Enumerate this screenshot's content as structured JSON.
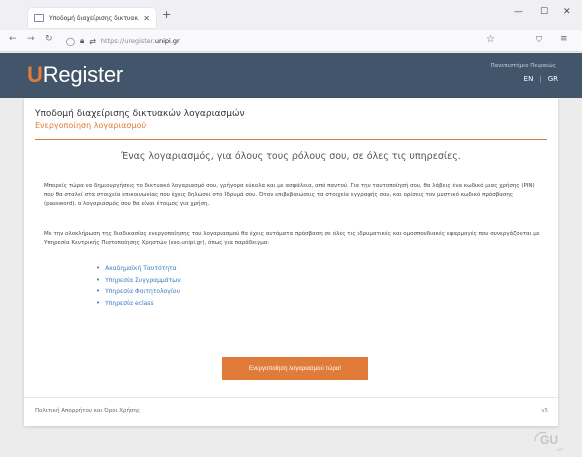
{
  "browser": {
    "tab_title": "Υποδομή διαχείρισης δικτυακ…",
    "url_prefix": "https://uregister.",
    "url_domain": "unipi.gr"
  },
  "header": {
    "logo_u": "U",
    "logo_rest": "Register",
    "university": "Πανεπιστήμιο Πειραιώς",
    "lang_en": "EN",
    "lang_gr": "GR"
  },
  "card": {
    "title": "Υποδομή διαχείρισης δικτυακών λογαριασμών",
    "subtitle": "Ενεργοποίηση λογαριασμού",
    "tagline": "Ένας λογαριασμός, για όλους τους ρόλους σου, σε όλες τις υπηρεσίες.",
    "para1": "Μπορείς τώρα να δημιουργήσεις το δικτυακό λογαριασμό σου, γρήγορα εύκολα και με ασφάλεια, από παντού. Για την ταυτοποίησή σου, θα λάβεις ένα κωδικό μιας χρήσης (PIN) που θα σταλεί στα στοιχεία επικοινωνίας που έχεις δηλώσει στο Ίδρυμά σου. Όταν επιβεβαιώσεις τα στοιχεία εγγραφής σου, και ορίσεις τον μυστικό κωδικό πρόσβασης (password), ο λογαριασμός σου θα είναι έτοιμος για χρήση.",
    "para2": "Με την ολοκλήρωση της διαδικασίας ενεργοποίησης του λογαριασμού θα έχεις αυτόματα πρόσβαση σε όλες τις ιδρυματικές και ομοσπονδιακές εφαρμογές που συνεργάζονται με Υπηρεσία Κεντρικής Πιστοποίησης Χρηστών (sso.unipi.gr), όπως για παράδειγμα:",
    "links": [
      "Ακαδημαϊκή Ταυτότητα",
      "Υπηρεσία Συγγραμμάτων",
      "Υπηρεσία Φοιτητολογίου",
      "Υπηρεσία eclass"
    ],
    "cta": "Ενεργοποίηση λογαριασμού τώρα!",
    "footer": "Πολιτική Απορρήτου και Όροι Χρήσης",
    "version": "v5"
  },
  "watermark": {
    "text": "GU",
    "sub": "net"
  },
  "colors": {
    "accent": "#e07b39",
    "header_bg": "#43556b",
    "link": "#3a7bbf"
  }
}
